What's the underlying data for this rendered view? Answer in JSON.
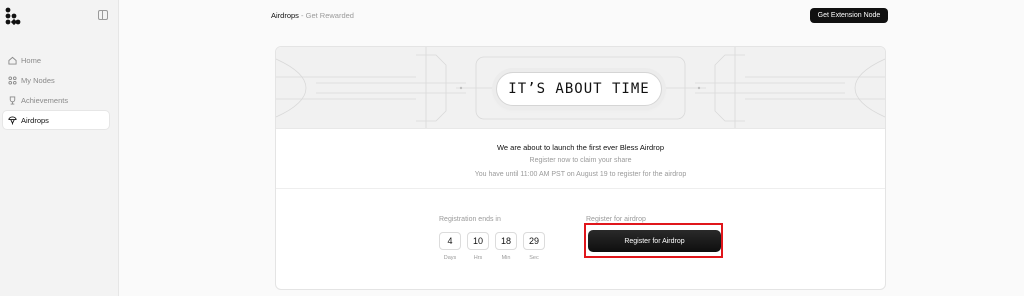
{
  "sidebar": {
    "items": [
      {
        "label": "Home",
        "icon": "home-icon"
      },
      {
        "label": "My Nodes",
        "icon": "nodes-icon"
      },
      {
        "label": "Achievements",
        "icon": "trophy-icon"
      },
      {
        "label": "Airdrops",
        "icon": "airdrop-icon",
        "active": true
      }
    ]
  },
  "header": {
    "title": "Airdrops",
    "separator": " - ",
    "subtitle": "Get Rewarded",
    "extension_button": "Get Extension Node"
  },
  "banner": {
    "headline": "IT’S ABOUT TIME"
  },
  "message": {
    "line1": "We are about to launch the first ever Bless Airdrop",
    "line2": "Register now to claim your share",
    "line3": "You have until 11:00 AM PST on August 19 to register for the airdrop"
  },
  "registration": {
    "ends_label": "Registration ends in",
    "countdown": [
      {
        "value": "4",
        "unit": "Days"
      },
      {
        "value": "10",
        "unit": "Hrs"
      },
      {
        "value": "18",
        "unit": "Min"
      },
      {
        "value": "29",
        "unit": "Sec"
      }
    ],
    "register_label": "Register for airdrop",
    "register_button": "Register for Airdrop"
  },
  "colors": {
    "accent": "#111111",
    "highlight": "#e0161b",
    "muted": "#9a9a9a"
  }
}
